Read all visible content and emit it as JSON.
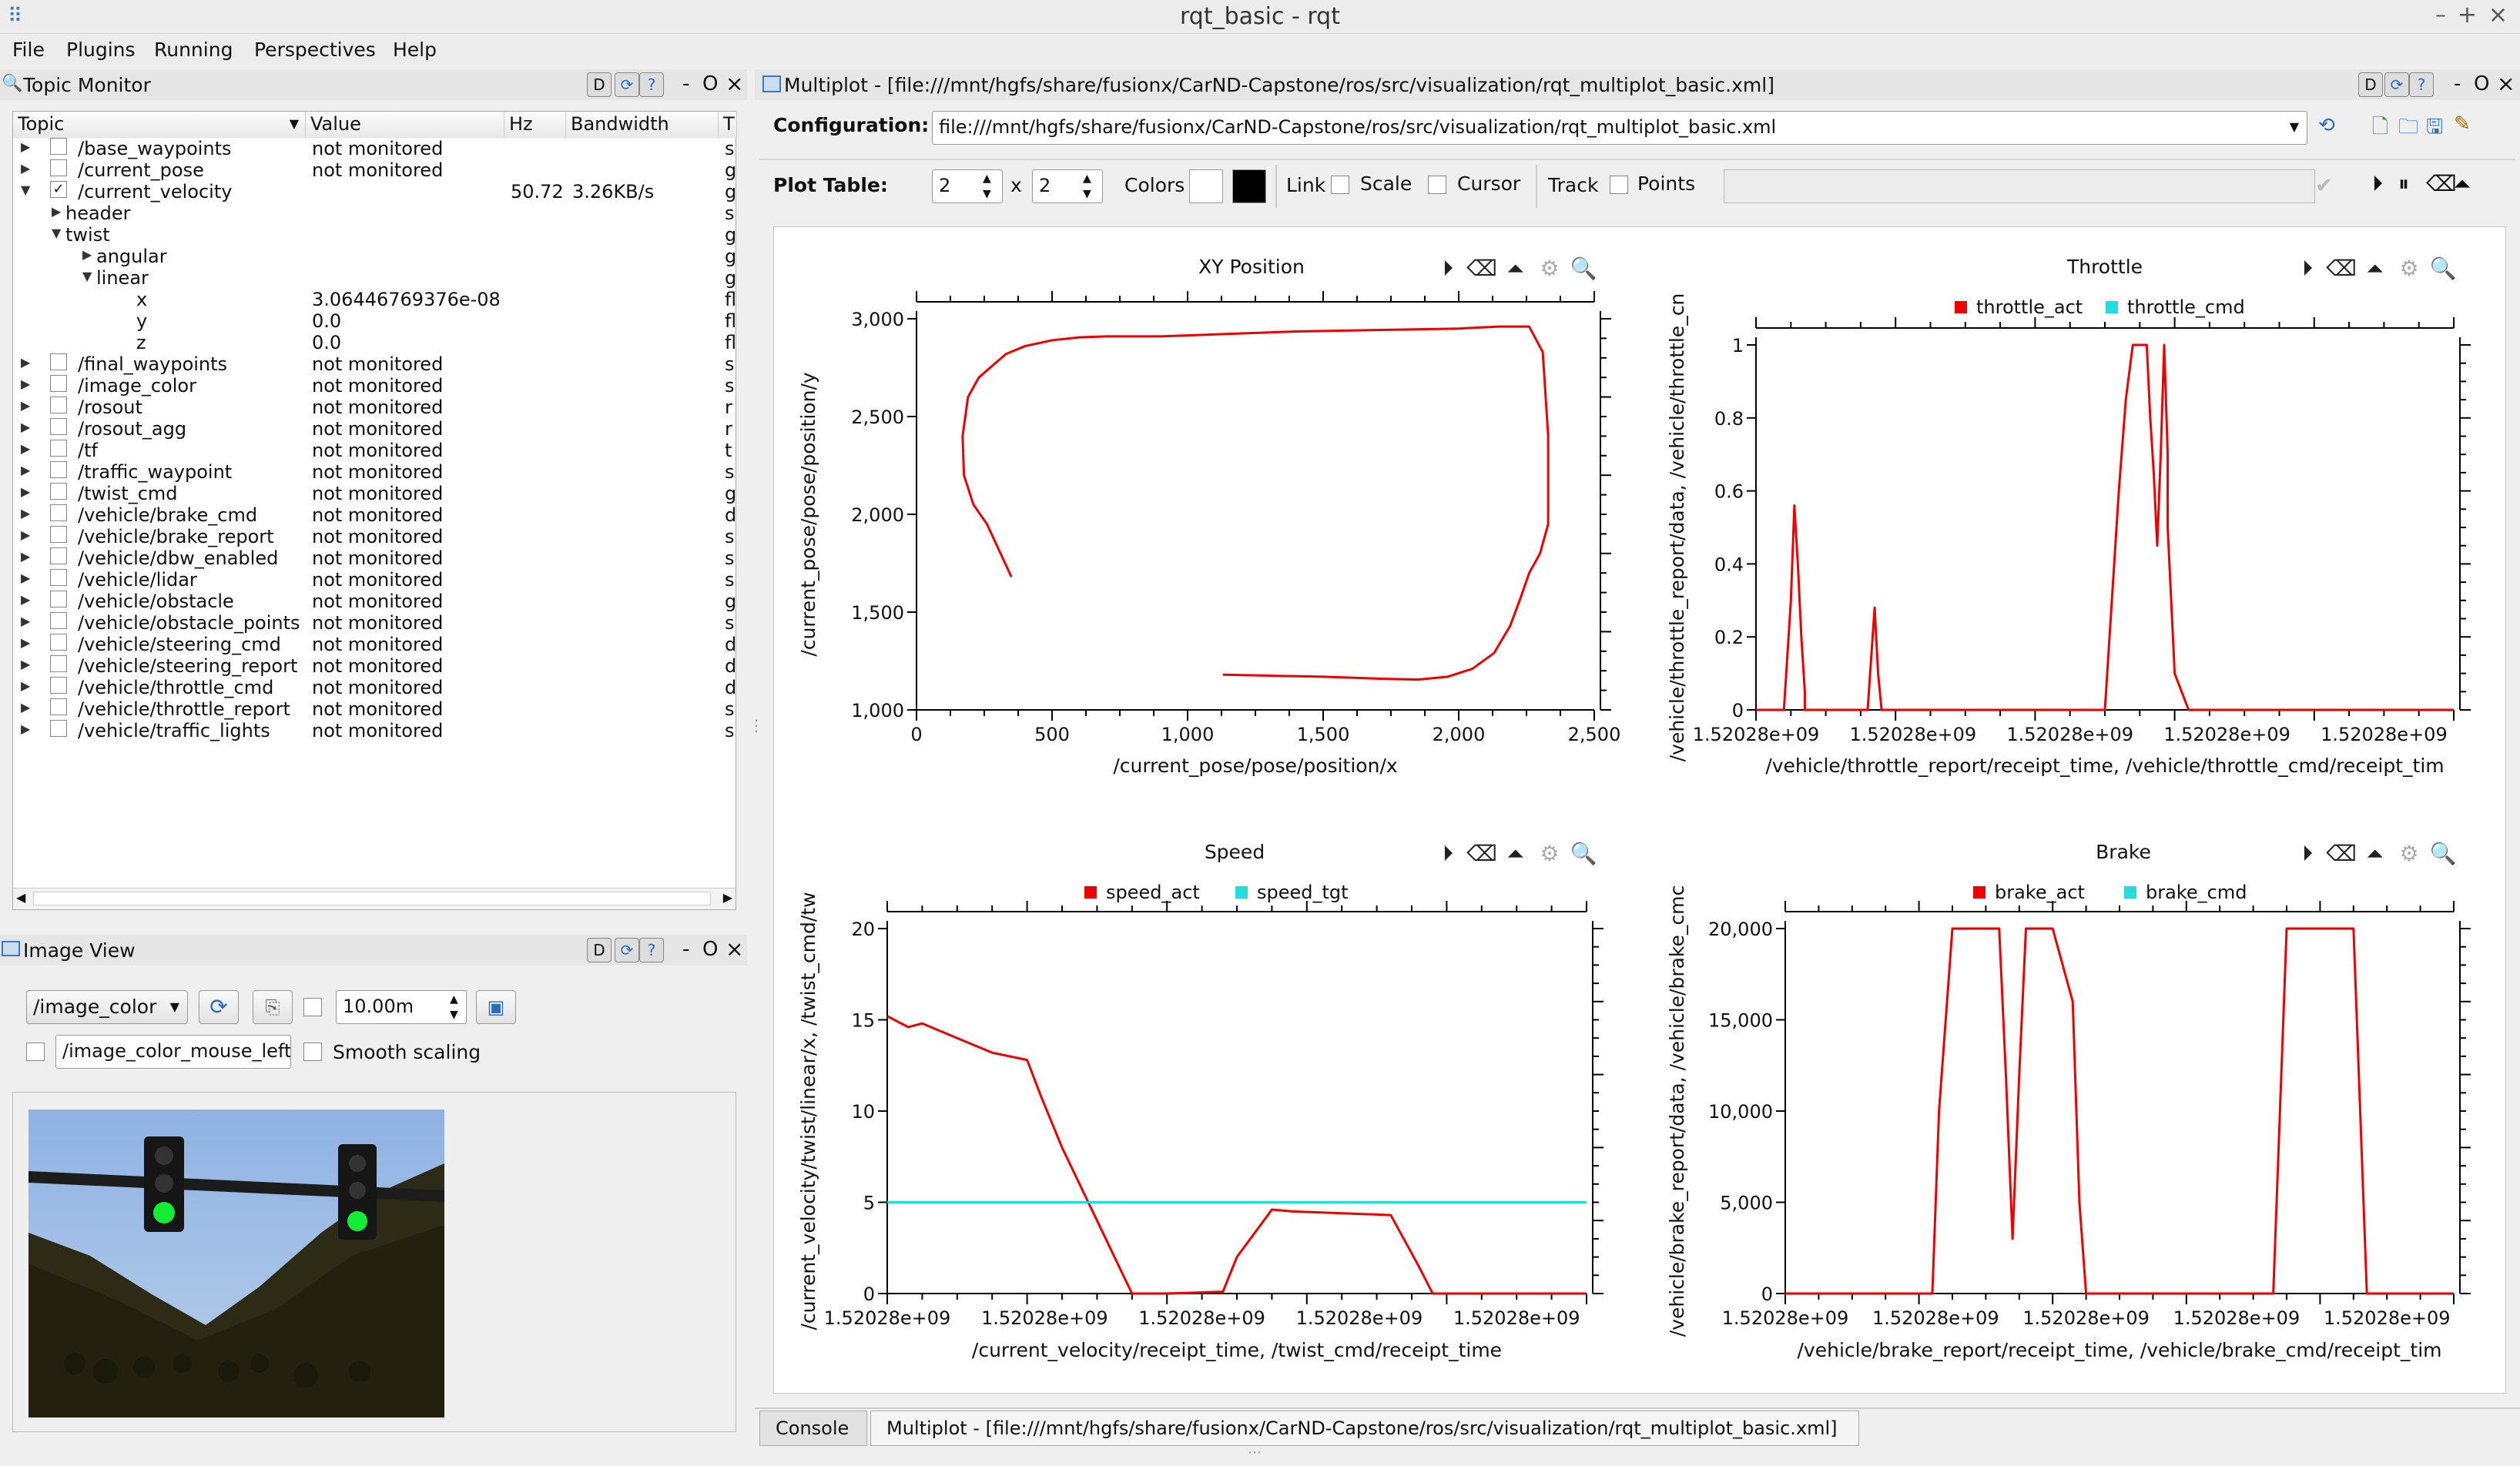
{
  "window": {
    "title": "rqt_basic - rqt"
  },
  "menu": [
    "File",
    "Plugins",
    "Running",
    "Perspectives",
    "Help"
  ],
  "topic_monitor": {
    "title": "Topic Monitor",
    "columns": [
      "Topic",
      "Value",
      "Hz",
      "Bandwidth",
      "T"
    ],
    "rows": [
      {
        "topic": "/base_waypoints",
        "value": "not monitored",
        "hz": "",
        "bw": "",
        "t": "s",
        "level": 0,
        "expand": "right",
        "check": false
      },
      {
        "topic": "/current_pose",
        "value": "not monitored",
        "hz": "",
        "bw": "",
        "t": "g",
        "level": 0,
        "expand": "right",
        "check": false
      },
      {
        "topic": "/current_velocity",
        "value": "",
        "hz": "50.72",
        "bw": "3.26KB/s",
        "t": "g",
        "level": 0,
        "expand": "down",
        "check": true
      },
      {
        "topic": "header",
        "value": "",
        "hz": "",
        "bw": "",
        "t": "s",
        "level": 1,
        "expand": "right",
        "check": null
      },
      {
        "topic": "twist",
        "value": "",
        "hz": "",
        "bw": "",
        "t": "g",
        "level": 1,
        "expand": "down",
        "check": null
      },
      {
        "topic": "angular",
        "value": "",
        "hz": "",
        "bw": "",
        "t": "g",
        "level": 2,
        "expand": "right",
        "check": null
      },
      {
        "topic": "linear",
        "value": "",
        "hz": "",
        "bw": "",
        "t": "g",
        "level": 2,
        "expand": "down",
        "check": null
      },
      {
        "topic": "x",
        "value": "3.06446769376e-08",
        "hz": "",
        "bw": "",
        "t": "fl",
        "level": 3,
        "expand": "",
        "check": null
      },
      {
        "topic": "y",
        "value": "0.0",
        "hz": "",
        "bw": "",
        "t": "fl",
        "level": 3,
        "expand": "",
        "check": null
      },
      {
        "topic": "z",
        "value": "0.0",
        "hz": "",
        "bw": "",
        "t": "fl",
        "level": 3,
        "expand": "",
        "check": null
      },
      {
        "topic": "/final_waypoints",
        "value": "not monitored",
        "hz": "",
        "bw": "",
        "t": "s",
        "level": 0,
        "expand": "right",
        "check": false
      },
      {
        "topic": "/image_color",
        "value": "not monitored",
        "hz": "",
        "bw": "",
        "t": "s",
        "level": 0,
        "expand": "right",
        "check": false
      },
      {
        "topic": "/rosout",
        "value": "not monitored",
        "hz": "",
        "bw": "",
        "t": "r",
        "level": 0,
        "expand": "right",
        "check": false
      },
      {
        "topic": "/rosout_agg",
        "value": "not monitored",
        "hz": "",
        "bw": "",
        "t": "r",
        "level": 0,
        "expand": "right",
        "check": false
      },
      {
        "topic": "/tf",
        "value": "not monitored",
        "hz": "",
        "bw": "",
        "t": "t",
        "level": 0,
        "expand": "right",
        "check": false
      },
      {
        "topic": "/traffic_waypoint",
        "value": "not monitored",
        "hz": "",
        "bw": "",
        "t": "s",
        "level": 0,
        "expand": "right",
        "check": false
      },
      {
        "topic": "/twist_cmd",
        "value": "not monitored",
        "hz": "",
        "bw": "",
        "t": "g",
        "level": 0,
        "expand": "right",
        "check": false
      },
      {
        "topic": "/vehicle/brake_cmd",
        "value": "not monitored",
        "hz": "",
        "bw": "",
        "t": "d",
        "level": 0,
        "expand": "right",
        "check": false
      },
      {
        "topic": "/vehicle/brake_report",
        "value": "not monitored",
        "hz": "",
        "bw": "",
        "t": "s",
        "level": 0,
        "expand": "right",
        "check": false
      },
      {
        "topic": "/vehicle/dbw_enabled",
        "value": "not monitored",
        "hz": "",
        "bw": "",
        "t": "s",
        "level": 0,
        "expand": "right",
        "check": false
      },
      {
        "topic": "/vehicle/lidar",
        "value": "not monitored",
        "hz": "",
        "bw": "",
        "t": "s",
        "level": 0,
        "expand": "right",
        "check": false
      },
      {
        "topic": "/vehicle/obstacle",
        "value": "not monitored",
        "hz": "",
        "bw": "",
        "t": "g",
        "level": 0,
        "expand": "right",
        "check": false
      },
      {
        "topic": "/vehicle/obstacle_points",
        "value": "not monitored",
        "hz": "",
        "bw": "",
        "t": "s",
        "level": 0,
        "expand": "right",
        "check": false
      },
      {
        "topic": "/vehicle/steering_cmd",
        "value": "not monitored",
        "hz": "",
        "bw": "",
        "t": "d",
        "level": 0,
        "expand": "right",
        "check": false
      },
      {
        "topic": "/vehicle/steering_report",
        "value": "not monitored",
        "hz": "",
        "bw": "",
        "t": "d",
        "level": 0,
        "expand": "right",
        "check": false
      },
      {
        "topic": "/vehicle/throttle_cmd",
        "value": "not monitored",
        "hz": "",
        "bw": "",
        "t": "d",
        "level": 0,
        "expand": "right",
        "check": false
      },
      {
        "topic": "/vehicle/throttle_report",
        "value": "not monitored",
        "hz": "",
        "bw": "",
        "t": "s",
        "level": 0,
        "expand": "right",
        "check": false
      },
      {
        "topic": "/vehicle/traffic_lights",
        "value": "not monitored",
        "hz": "",
        "bw": "",
        "t": "s",
        "level": 0,
        "expand": "right",
        "check": false
      }
    ]
  },
  "image_view": {
    "title": "Image View",
    "topic": "/image_color",
    "timeout": "10.00m",
    "mouse_topic": "/image_color_mouse_left",
    "smooth_label": "Smooth scaling"
  },
  "multiplot": {
    "title": "Multiplot - [file:///mnt/hgfs/share/fusionx/CarND-Capstone/ros/src/visualization/rqt_multiplot_basic.xml]",
    "config_label": "Configuration:",
    "config_value": "file:///mnt/hgfs/share/fusionx/CarND-Capstone/ros/src/visualization/rqt_multiplot_basic.xml",
    "plot_table_label": "Plot Table:",
    "rows": "2",
    "x_sep": "x",
    "cols": "2",
    "colors_label": "Colors",
    "link_label": "Link",
    "scale_label": "Scale",
    "cursor_label": "Cursor",
    "track_label": "Track",
    "points_label": "Points"
  },
  "bottom_tabs": {
    "console": "Console",
    "multiplot": "Multiplot - [file:///mnt/hgfs/share/fusionx/CarND-Capstone/ros/src/visualization/rqt_multiplot_basic.xml]"
  },
  "colors": {
    "red": "#ee0000",
    "cyan": "#22dddd"
  },
  "chart_data": [
    {
      "type": "line",
      "title": "XY Position",
      "xlabel": "/current_pose/pose/position/x",
      "ylabel": "/current_pose/pose/position/y",
      "xlim": [
        0,
        2500
      ],
      "ylim": [
        1000,
        3000
      ],
      "xticks": [
        "0",
        "500",
        "1,000",
        "1,500",
        "2,000",
        "2,500"
      ],
      "yticks": [
        "1,000",
        "1,500",
        "2,000",
        "2,500",
        "3,000"
      ],
      "series": [
        {
          "color": "#ee0000",
          "x": [
            1130,
            1300,
            1500,
            1700,
            1850,
            1960,
            2050,
            2130,
            2190,
            2230,
            2260,
            2300,
            2330,
            2330,
            2310,
            2260,
            2150,
            2000,
            1800,
            1600,
            1400,
            1200,
            1000,
            900,
            800,
            700,
            600,
            500,
            400,
            330,
            280,
            230,
            190,
            170,
            175,
            210,
            260,
            310,
            350
          ],
          "y": [
            1180,
            1175,
            1170,
            1160,
            1155,
            1170,
            1210,
            1290,
            1430,
            1580,
            1700,
            1800,
            1950,
            2400,
            2830,
            2960,
            2960,
            2950,
            2945,
            2940,
            2935,
            2925,
            2915,
            2910,
            2910,
            2910,
            2905,
            2890,
            2860,
            2820,
            2760,
            2700,
            2600,
            2400,
            2200,
            2050,
            1950,
            1800,
            1680
          ]
        }
      ]
    },
    {
      "type": "line",
      "title": "Throttle",
      "xlabel": "/vehicle/throttle_report/receipt_time, /vehicle/throttle_cmd/receipt_tim",
      "ylabel": "/vehicle/throttle_report/data, /vehicle/throttle_cn",
      "ylim": [
        0,
        1
      ],
      "xticks": [
        "1.52028e+09",
        "1.52028e+09",
        "1.52028e+09",
        "1.52028e+09",
        "1.52028e+09"
      ],
      "yticks": [
        "0",
        "0.2",
        "0.4",
        "0.6",
        "0.8",
        "1"
      ],
      "series": [
        {
          "name": "throttle_act",
          "color": "#ee0000",
          "x": [
            0,
            0.04,
            0.05,
            0.055,
            0.06,
            0.065,
            0.07,
            0.07,
            0.16,
            0.17,
            0.175,
            0.18,
            0.19,
            0.5,
            0.51,
            0.52,
            0.53,
            0.54,
            0.55,
            0.56,
            0.56,
            0.565,
            0.57,
            0.575,
            0.58,
            0.585,
            0.59,
            0.59,
            0.6,
            0.62,
            1
          ],
          "y": [
            0,
            0,
            0.3,
            0.56,
            0.4,
            0.2,
            0.05,
            0,
            0,
            0.28,
            0.1,
            0,
            0,
            0,
            0.3,
            0.6,
            0.85,
            1,
            1,
            1,
            1,
            0.8,
            0.65,
            0.45,
            0.7,
            1,
            0.7,
            0.5,
            0.1,
            0,
            0
          ]
        },
        {
          "name": "throttle_cmd",
          "color": "#22dddd",
          "x": [],
          "y": []
        }
      ]
    },
    {
      "type": "line",
      "title": "Speed",
      "xlabel": "/current_velocity/receipt_time, /twist_cmd/receipt_time",
      "ylabel": "/current_velocity/twist/linear/x, /twist_cmd/tw",
      "ylim": [
        0,
        20
      ],
      "xticks": [
        "1.52028e+09",
        "1.52028e+09",
        "1.52028e+09",
        "1.52028e+09",
        "1.52028e+09"
      ],
      "yticks": [
        "0",
        "5",
        "10",
        "15",
        "20"
      ],
      "series": [
        {
          "name": "speed_act",
          "color": "#ee0000",
          "x": [
            0,
            0.03,
            0.05,
            0.1,
            0.15,
            0.2,
            0.22,
            0.25,
            0.3,
            0.35,
            0.4,
            0.4,
            0.48,
            0.5,
            0.55,
            0.58,
            0.72,
            0.76,
            0.78,
            1
          ],
          "y": [
            15.2,
            14.6,
            14.8,
            14.0,
            13.2,
            12.8,
            10.8,
            8.0,
            4.0,
            0,
            0,
            0,
            0.1,
            2.0,
            4.6,
            4.5,
            4.3,
            1.5,
            0,
            0
          ]
        },
        {
          "name": "speed_tgt",
          "color": "#22dddd",
          "x": [
            0,
            1
          ],
          "y": [
            5,
            5
          ]
        }
      ]
    },
    {
      "type": "line",
      "title": "Brake",
      "xlabel": "/vehicle/brake_report/receipt_time, /vehicle/brake_cmd/receipt_tim",
      "ylabel": "/vehicle/brake_report/data, /vehicle/brake_cmc",
      "ylim": [
        0,
        20000
      ],
      "xticks": [
        "1.52028e+09",
        "1.52028e+09",
        "1.52028e+09",
        "1.52028e+09",
        "1.52028e+09"
      ],
      "yticks": [
        "0",
        "5,000",
        "10,000",
        "15,000",
        "20,000"
      ],
      "series": [
        {
          "name": "brake_act",
          "color": "#ee0000",
          "x": [
            0,
            0.22,
            0.23,
            0.25,
            0.32,
            0.33,
            0.34,
            0.35,
            0.36,
            0.37,
            0.38,
            0.4,
            0.43,
            0.44,
            0.45,
            0.73,
            0.74,
            0.75,
            0.85,
            0.86,
            0.87,
            1
          ],
          "y": [
            0,
            0,
            10000,
            20000,
            20000,
            12000,
            3000,
            12000,
            20000,
            20000,
            20000,
            20000,
            16000,
            5000,
            0,
            0,
            10000,
            20000,
            20000,
            10000,
            0,
            0
          ]
        },
        {
          "name": "brake_cmd",
          "color": "#22dddd",
          "x": [],
          "y": []
        }
      ]
    }
  ]
}
